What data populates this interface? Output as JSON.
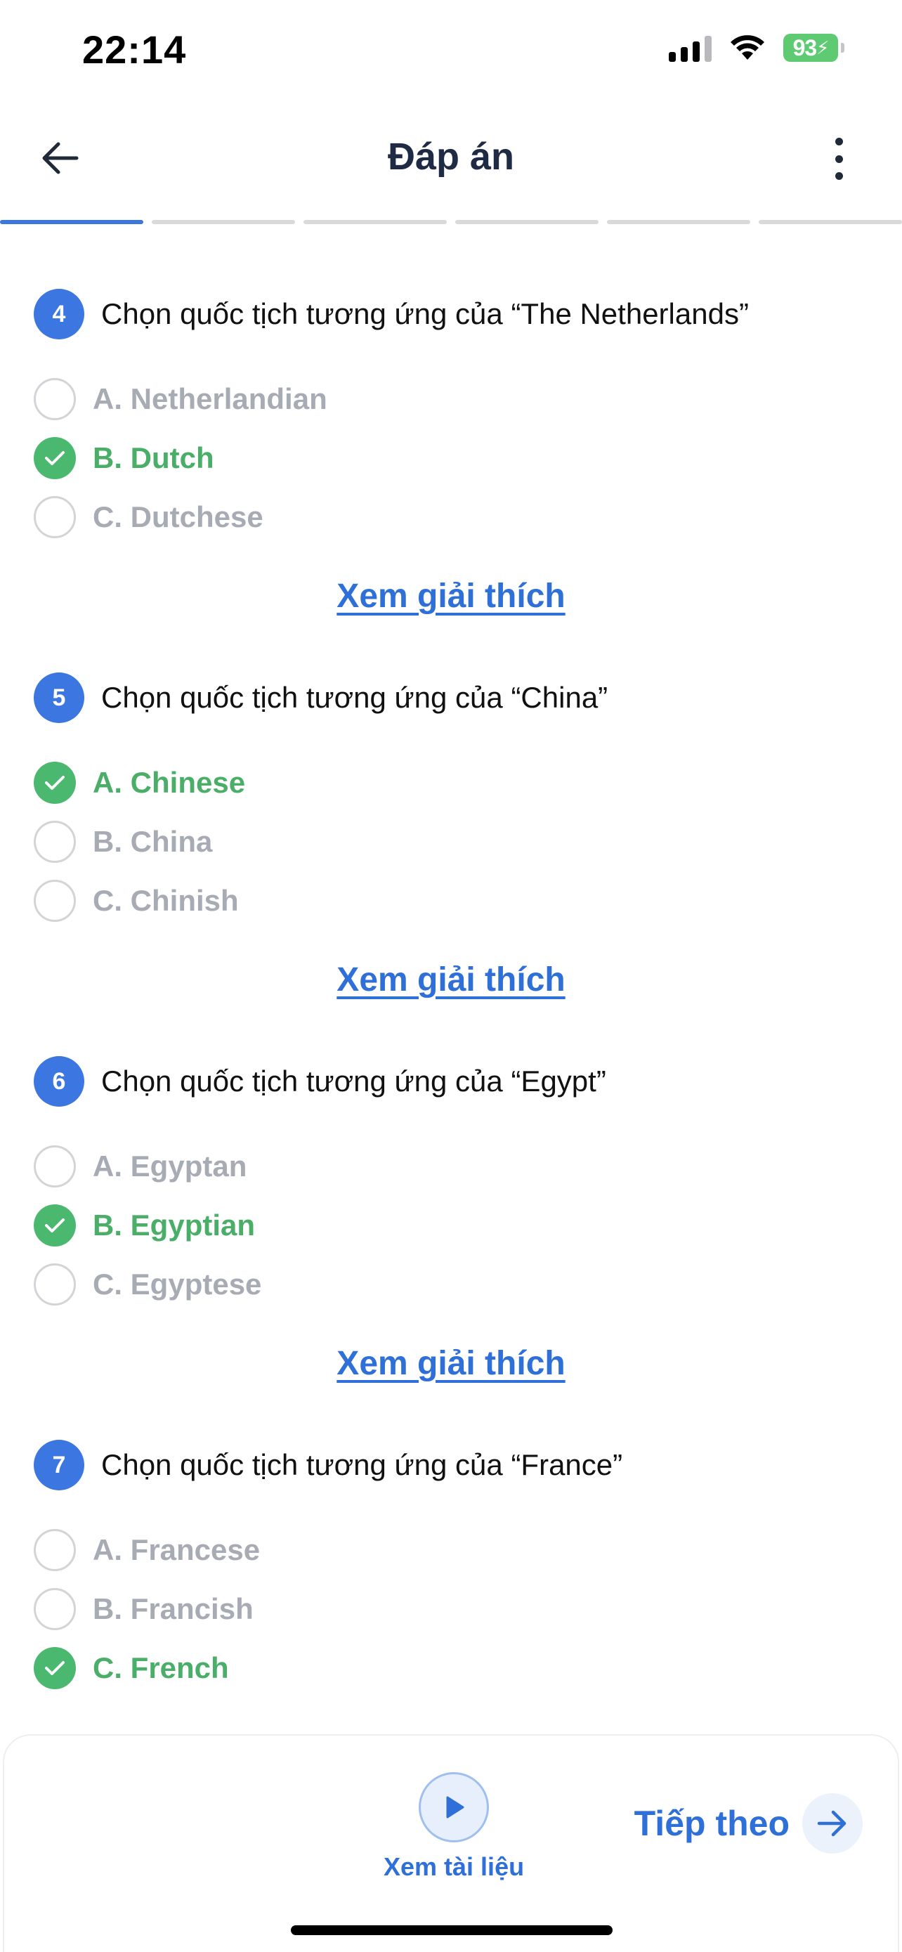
{
  "status_bar": {
    "time": "22:14",
    "battery": "93"
  },
  "header": {
    "title": "Đáp án"
  },
  "progress": {
    "segments": 6,
    "active_index": 0
  },
  "questions": [
    {
      "number": "4",
      "text": "Chọn quốc tịch tương ứng của “The Netherlands”",
      "options": [
        {
          "label": "A. Netherlandian",
          "correct": false
        },
        {
          "label": "B. Dutch",
          "correct": true
        },
        {
          "label": "C. Dutchese",
          "correct": false
        }
      ],
      "explain_label": "Xem giải thích"
    },
    {
      "number": "5",
      "text": "Chọn quốc tịch tương ứng của “China”",
      "options": [
        {
          "label": "A. Chinese",
          "correct": true
        },
        {
          "label": "B. China",
          "correct": false
        },
        {
          "label": "C. Chinish",
          "correct": false
        }
      ],
      "explain_label": "Xem giải thích"
    },
    {
      "number": "6",
      "text": "Chọn quốc tịch tương ứng của “Egypt”",
      "options": [
        {
          "label": "A. Egyptan",
          "correct": false
        },
        {
          "label": "B. Egyptian",
          "correct": true
        },
        {
          "label": "C. Egyptese",
          "correct": false
        }
      ],
      "explain_label": "Xem giải thích"
    },
    {
      "number": "7",
      "text": "Chọn quốc tịch tương ứng của “France”",
      "options": [
        {
          "label": "A. Francese",
          "correct": false
        },
        {
          "label": "B. Francish",
          "correct": false
        },
        {
          "label": "C. French",
          "correct": true
        }
      ]
    }
  ],
  "bottom_bar": {
    "docs_label": "Xem tài liệu",
    "next_label": "Tiếp theo"
  },
  "colors": {
    "accent": "#2f6fd8",
    "correct": "#4aae68",
    "muted": "#a7abb3",
    "battery": "#5ecb72"
  }
}
